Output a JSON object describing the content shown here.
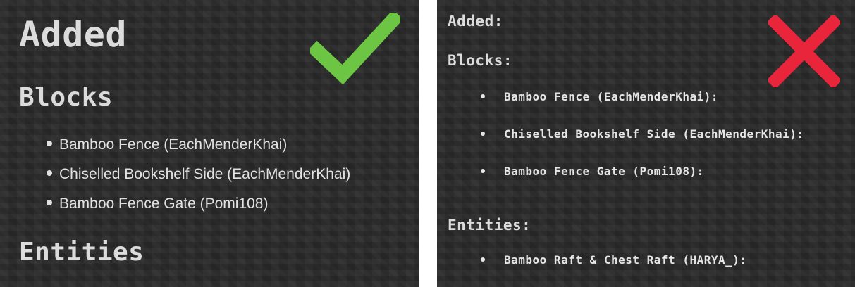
{
  "left_panel": {
    "heading_added": "Added",
    "heading_blocks": "Blocks",
    "blocks": [
      "Bamboo Fence (EachMenderKhai)",
      "Chiselled Bookshelf Side (EachMenderKhai)",
      "Bamboo Fence Gate (Pomi108)"
    ],
    "heading_entities": "Entities",
    "marker_icon": "checkmark-icon",
    "marker_color": "#6cc644"
  },
  "right_panel": {
    "heading_added": "Added:",
    "heading_blocks": "Blocks:",
    "blocks": [
      "Bamboo Fence (EachMenderKhai):",
      "Chiselled Bookshelf Side (EachMenderKhai):",
      "Bamboo Fence Gate (Pomi108):"
    ],
    "heading_entities": "Entities:",
    "entities": [
      "Bamboo Raft & Chest Raft (HARYA_):"
    ],
    "marker_icon": "cross-icon",
    "marker_color": "#e8253a"
  },
  "background_color": "#2a2a2a"
}
